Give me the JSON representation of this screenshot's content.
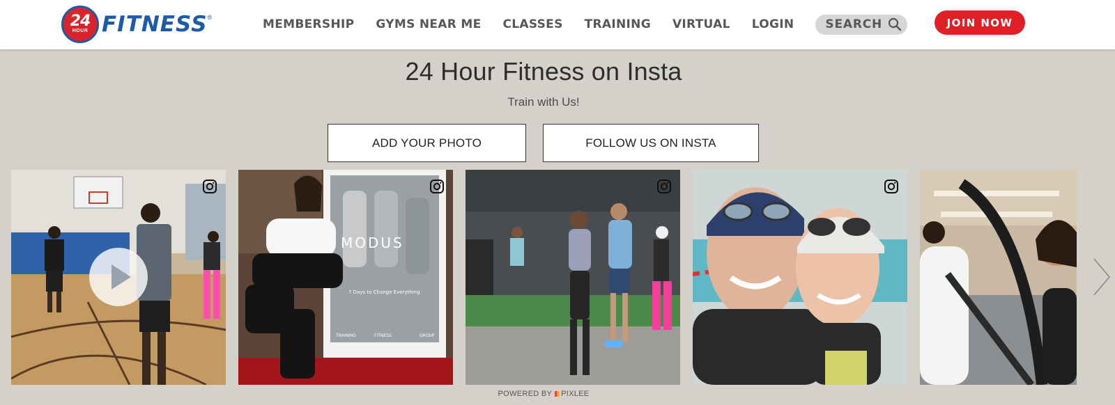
{
  "header": {
    "logo": {
      "number": "24",
      "hour": "HOUR",
      "word": "FITNESS",
      "mark": "®"
    },
    "nav": [
      "MEMBERSHIP",
      "GYMS NEAR ME",
      "CLASSES",
      "TRAINING",
      "VIRTUAL",
      "LOGIN"
    ],
    "search_label": "SEARCH",
    "join_label": "JOIN NOW"
  },
  "section": {
    "title": "24 Hour Fitness on Insta",
    "subtitle": "Train with Us!",
    "add_photo_label": "ADD YOUR PHOTO",
    "follow_label": "FOLLOW US ON INSTA",
    "powered_prefix": "POWERED BY",
    "powered_brand": "PIXLEE",
    "tiles": [
      {
        "kind": "video",
        "icon": "instagram-icon"
      },
      {
        "kind": "photo",
        "icon": "instagram-icon",
        "sign_text": "MODUS",
        "sign_tagline": "7 Days to Change Everything",
        "sign_footer": [
          "TRAINING",
          "FITNESS",
          "GROUP"
        ]
      },
      {
        "kind": "photo",
        "icon": "instagram-icon"
      },
      {
        "kind": "photo",
        "icon": "instagram-icon"
      },
      {
        "kind": "photo"
      }
    ]
  },
  "colors": {
    "brand_red": "#e01f26",
    "brand_blue": "#1d5aa8",
    "section_bg": "#d3d1c9"
  }
}
